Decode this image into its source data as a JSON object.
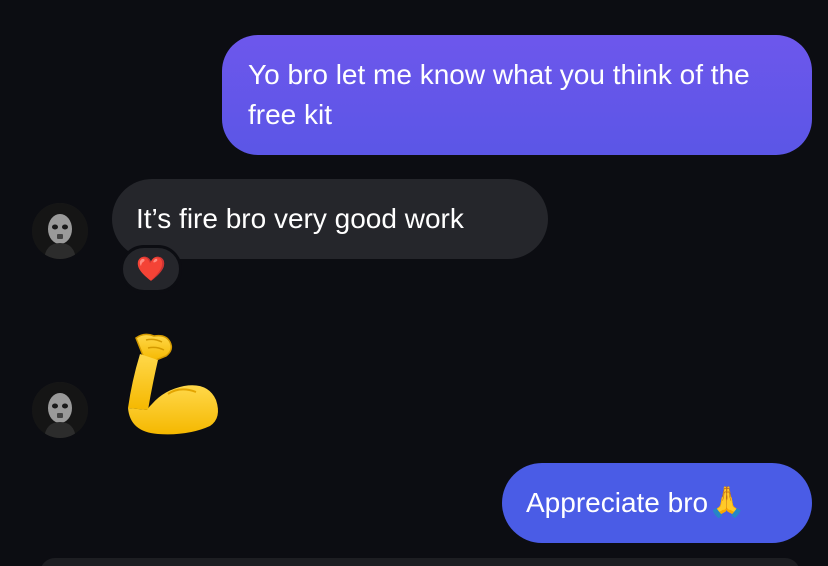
{
  "messages": [
    {
      "direction": "outgoing",
      "text": "Yo bro let me know what you think of the free kit"
    },
    {
      "direction": "incoming",
      "text": "It’s fire bro very good work",
      "reaction": "❤️"
    },
    {
      "direction": "incoming",
      "emoji_name": "flexed-biceps"
    },
    {
      "direction": "outgoing",
      "text": "Appreciate bro",
      "emoji": "🙏"
    }
  ],
  "colors": {
    "background": "#0c0d12",
    "outgoing_bubble": "#5b56e6",
    "incoming_bubble": "#25262b",
    "outgoing_bubble_2": "#4a5ce6",
    "text": "#ffffff"
  }
}
